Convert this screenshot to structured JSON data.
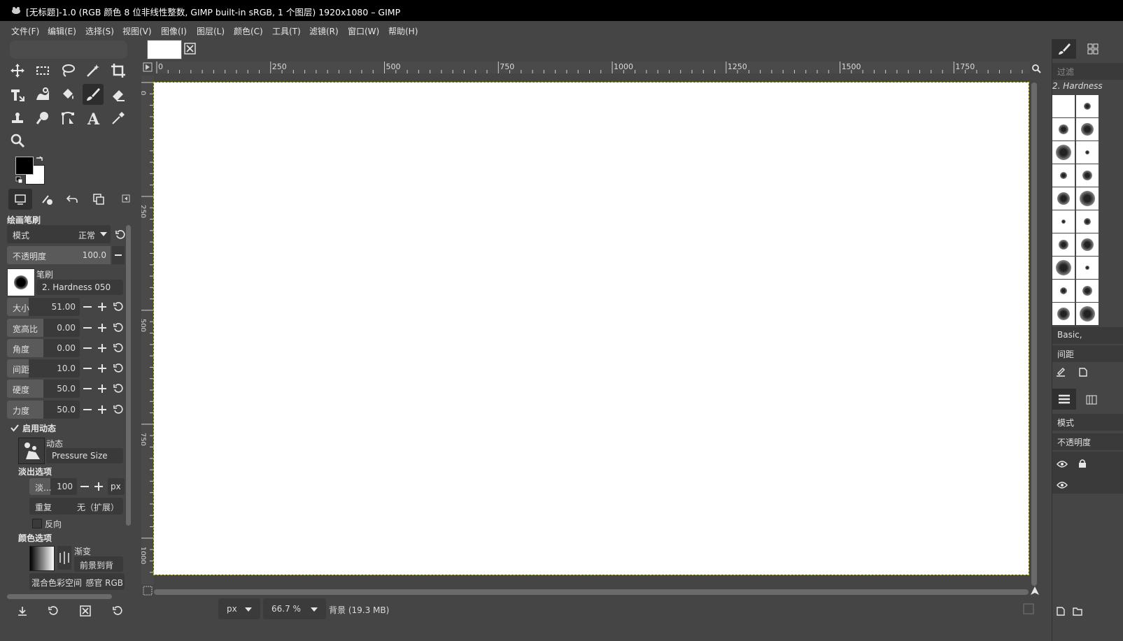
{
  "window": {
    "title": "[无标题]-1.0 (RGB 颜色 8 位非线性整数, GIMP built-in sRGB, 1 个图层) 1920x1080 – GIMP"
  },
  "menu": [
    "文件(F)",
    "编辑(E)",
    "选择(S)",
    "视图(V)",
    "图像(I)",
    "图层(L)",
    "颜色(C)",
    "工具(T)",
    "滤镜(R)",
    "窗口(W)",
    "帮助(H)"
  ],
  "tool_options": {
    "title": "绘画笔刷",
    "mode_label": "模式",
    "mode_value": "正常",
    "opacity_label": "不透明度",
    "opacity_value": "100.0",
    "brush_label": "笔刷",
    "brush_name": "2. Hardness 050",
    "params": [
      {
        "label": "大小",
        "value": "51.00",
        "fill": 0.3
      },
      {
        "label": "宽高比",
        "value": "0.00",
        "fill": 0.5
      },
      {
        "label": "角度",
        "value": "0.00",
        "fill": 0.5
      },
      {
        "label": "间距",
        "value": "10.0",
        "fill": 0.3
      },
      {
        "label": "硬度",
        "value": "50.0",
        "fill": 0.5
      },
      {
        "label": "力度",
        "value": "50.0",
        "fill": 0.5
      }
    ],
    "dynamics_enable": "启用动态",
    "dynamics_label": "动态",
    "dynamics_value": "Pressure Size",
    "fade_title": "淡出选项",
    "fade_label": "淡...",
    "fade_value": "100",
    "fade_unit": "px",
    "repeat_label": "重复",
    "repeat_value": "无（扩展）",
    "reverse_label": "反向",
    "color_title": "颜色选项",
    "gradient_label": "渐变",
    "gradient_value": "前景到背",
    "blend_label": "混合色彩空间",
    "blend_value": "感官 RGB"
  },
  "ruler": {
    "h_labels": [
      "0",
      "250",
      "500",
      "750",
      "1000",
      "1250",
      "1500",
      "1750"
    ],
    "v_labels": [
      "0",
      "250",
      "500",
      "750",
      "1000"
    ]
  },
  "status": {
    "unit": "px",
    "zoom": "66.7 %",
    "info": "背景 (19.3 MB)"
  },
  "right_panel": {
    "filter_placeholder": "过滤",
    "brush_title": "2. Hardness",
    "brush_tag": "Basic,",
    "spacing_label": "间距",
    "layers_mode": "模式",
    "layers_opacity": "不透明度"
  },
  "colors": {
    "foreground": "#000000",
    "background": "#ffffff",
    "accent": "#c8c800"
  }
}
